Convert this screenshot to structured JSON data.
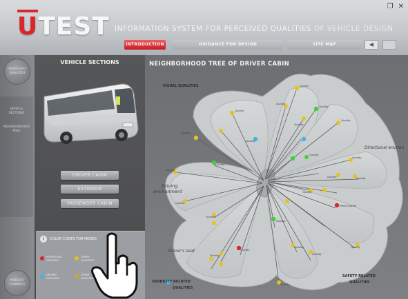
{
  "window": {
    "restore_glyph": "❐",
    "close_glyph": "✕"
  },
  "header": {
    "logo_first": "U",
    "logo_rest": "TEST",
    "title": "INFORMATION SYSTEM FOR PERCEIVED QUALITIES",
    "subtitle": "OF VEHICLE DESIGN"
  },
  "nav": {
    "tabs": [
      {
        "label": "INTRODUCTION",
        "active": true
      },
      {
        "label": "GUIDANCE FOR DESIGN",
        "active": false
      },
      {
        "label": "SITE MAP",
        "active": false
      }
    ],
    "small_button_glyph": "◀"
  },
  "rail": {
    "top_label": "PERCEIVED QUALITIES",
    "items": [
      "VEHICLE SECTIONS",
      "NEIGHBORHOOD TREE"
    ],
    "bottom_label": "PRODUCT EXAMPLES"
  },
  "left_panel": {
    "title": "VEHICLE SECTIONS",
    "sections": [
      "DRIVER CABIN",
      "EXTERIOR",
      "PASSENGER CABIN"
    ],
    "legend_title": "COLOR CODES FOR NODES",
    "legend_items": [
      {
        "label": "PERCEPTUAL",
        "sub": "QUALITIES",
        "color": "#d8262c"
      },
      {
        "label": "OTHER",
        "sub": "QUALITIES",
        "color": "#e2c21a"
      },
      {
        "label": "DRIVING",
        "sub": "QUALITIES",
        "color": "#3fb6e6"
      },
      {
        "label": "OTHER",
        "sub": "QUALITIES",
        "color": "#d9a51c"
      }
    ]
  },
  "main": {
    "title": "NEIGHBORHOOD TREE OF DRIVER CABIN",
    "regions": {
      "visual": "VISUAL QUALITIES",
      "driving_env_1": "Driving",
      "driving_env_2": "environment",
      "directional": "Directional environ",
      "drivers_seat": "Driver's seat",
      "usability_1": "USABILITY RELATED",
      "usability_2": "QUALITIES",
      "safety_1": "SAFETY RELATED",
      "safety_2": "QUALITIES"
    },
    "node_label": "Quality",
    "node_label_alt": "Wind Quality"
  },
  "colors": {
    "accent_red": "#d8262c",
    "node_yellow": "#e6c21c",
    "node_green": "#3fcf3a",
    "node_blue": "#3fb6e6",
    "petal": "#cfd3d3"
  }
}
